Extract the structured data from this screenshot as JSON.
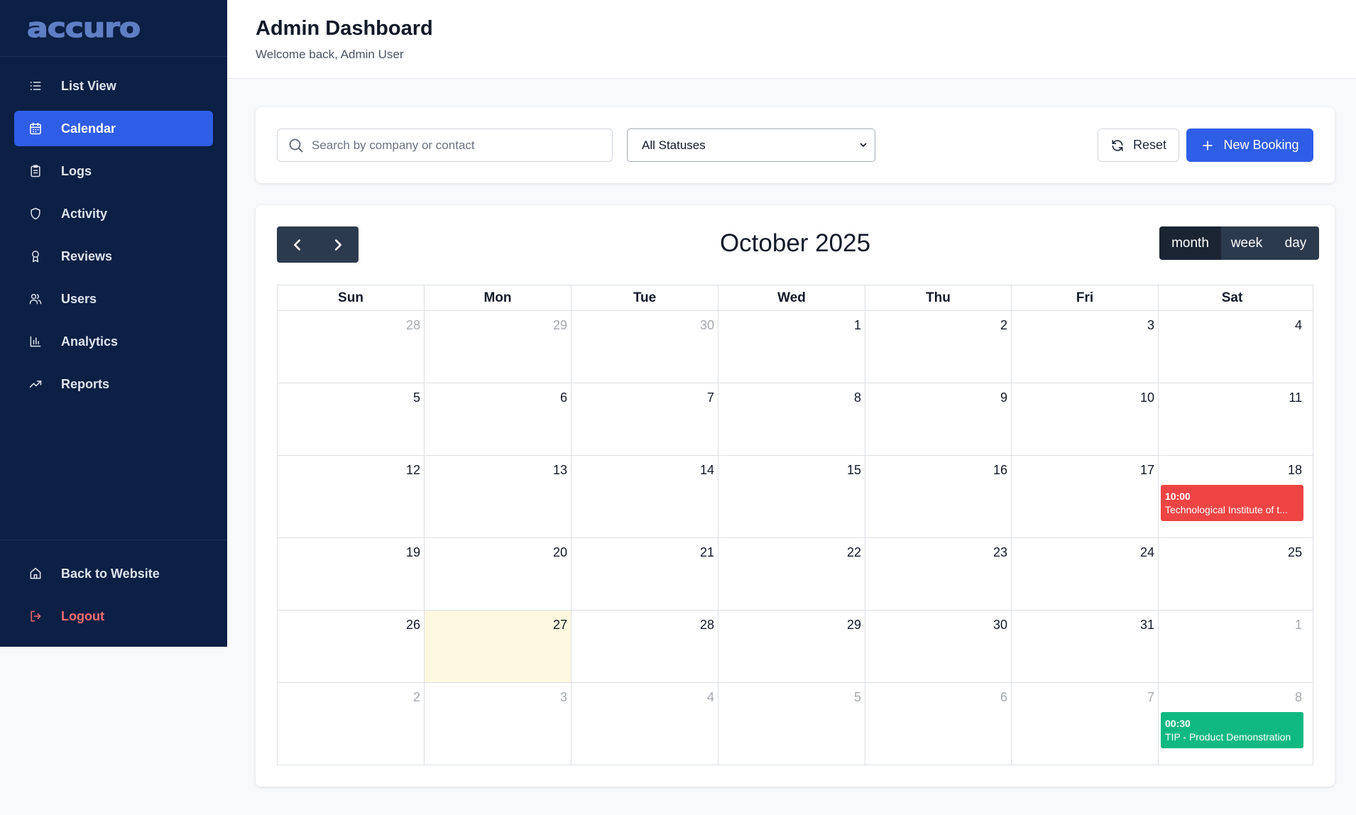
{
  "brand": {
    "logo": "accuro"
  },
  "sidebar": {
    "items": [
      {
        "label": "List View",
        "icon": "list-icon",
        "active": false
      },
      {
        "label": "Calendar",
        "icon": "calendar-icon",
        "active": true
      },
      {
        "label": "Logs",
        "icon": "clipboard-icon",
        "active": false
      },
      {
        "label": "Activity",
        "icon": "shield-icon",
        "active": false
      },
      {
        "label": "Reviews",
        "icon": "award-icon",
        "active": false
      },
      {
        "label": "Users",
        "icon": "users-icon",
        "active": false
      },
      {
        "label": "Analytics",
        "icon": "bar-chart-icon",
        "active": false
      },
      {
        "label": "Reports",
        "icon": "trending-up-icon",
        "active": false
      }
    ],
    "bottom": [
      {
        "label": "Back to Website",
        "icon": "home-icon"
      },
      {
        "label": "Logout",
        "icon": "logout-icon"
      }
    ]
  },
  "header": {
    "title": "Admin Dashboard",
    "subtitle": "Welcome back, Admin User"
  },
  "toolbar": {
    "search_placeholder": "Search by company or contact",
    "search_value": "",
    "status_selected": "All Statuses",
    "reset_label": "Reset",
    "new_booking_label": "New Booking"
  },
  "calendar": {
    "title": "October 2025",
    "views": [
      "month",
      "week",
      "day"
    ],
    "active_view": "month",
    "days_of_week": [
      "Sun",
      "Mon",
      "Tue",
      "Wed",
      "Thu",
      "Fri",
      "Sat"
    ],
    "weeks": [
      [
        {
          "d": "28",
          "other": true
        },
        {
          "d": "29",
          "other": true
        },
        {
          "d": "30",
          "other": true
        },
        {
          "d": "1"
        },
        {
          "d": "2"
        },
        {
          "d": "3"
        },
        {
          "d": "4"
        }
      ],
      [
        {
          "d": "5"
        },
        {
          "d": "6"
        },
        {
          "d": "7"
        },
        {
          "d": "8"
        },
        {
          "d": "9"
        },
        {
          "d": "10"
        },
        {
          "d": "11"
        }
      ],
      [
        {
          "d": "12"
        },
        {
          "d": "13"
        },
        {
          "d": "14"
        },
        {
          "d": "15"
        },
        {
          "d": "16"
        },
        {
          "d": "17"
        },
        {
          "d": "18",
          "event": {
            "time": "10:00",
            "title": "Technological Institute of t...",
            "color": "#ef4444"
          }
        }
      ],
      [
        {
          "d": "19"
        },
        {
          "d": "20"
        },
        {
          "d": "21"
        },
        {
          "d": "22"
        },
        {
          "d": "23"
        },
        {
          "d": "24"
        },
        {
          "d": "25"
        }
      ],
      [
        {
          "d": "26"
        },
        {
          "d": "27",
          "today": true
        },
        {
          "d": "28"
        },
        {
          "d": "29"
        },
        {
          "d": "30"
        },
        {
          "d": "31"
        },
        {
          "d": "1",
          "other": true
        }
      ],
      [
        {
          "d": "2",
          "other": true
        },
        {
          "d": "3",
          "other": true
        },
        {
          "d": "4",
          "other": true
        },
        {
          "d": "5",
          "other": true
        },
        {
          "d": "6",
          "other": true
        },
        {
          "d": "7",
          "other": true
        },
        {
          "d": "8",
          "other": true,
          "event": {
            "time": "00:30",
            "title": "TIP - Product Demonstration",
            "color": "#10b981"
          }
        }
      ]
    ]
  },
  "colors": {
    "sidebar_bg": "#0c1f44",
    "accent": "#2f5ee6",
    "logout": "#f26d6d",
    "today_bg": "#fef8df",
    "nav_dark": "#2c3a4e"
  }
}
